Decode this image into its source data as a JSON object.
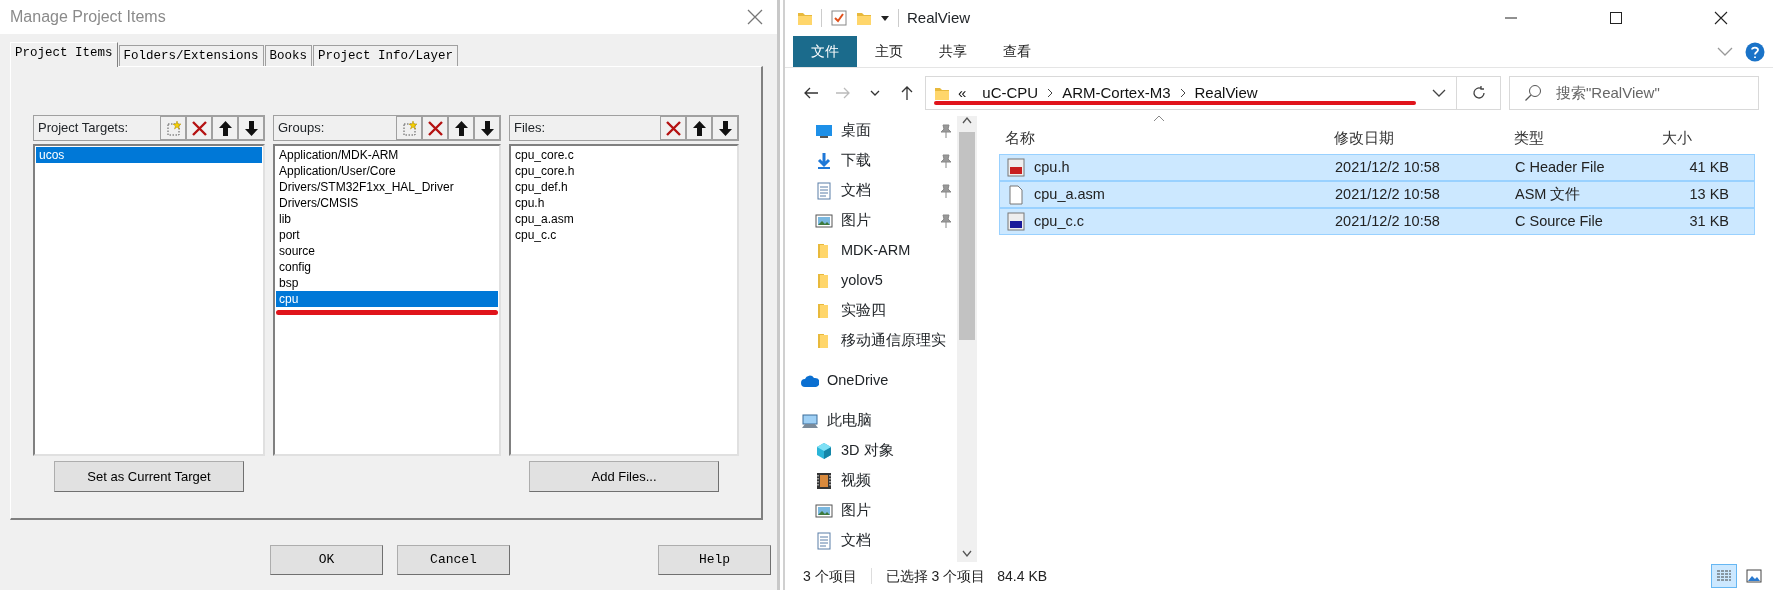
{
  "dialog": {
    "title": "Manage Project Items",
    "tabs": [
      {
        "label": "Project Items",
        "selected": true
      },
      {
        "label": "Folders/Extensions",
        "selected": false
      },
      {
        "label": "Books",
        "selected": false
      },
      {
        "label": "Project Info/Layer",
        "selected": false
      }
    ],
    "panels": [
      {
        "label": "Project Targets:",
        "tools": [
          {
            "kind": "new"
          },
          {
            "kind": "delete"
          },
          {
            "kind": "up"
          },
          {
            "kind": "down"
          }
        ],
        "items": [
          {
            "label": "ucos",
            "selected": true,
            "underlined": false
          }
        ],
        "button": "Set as Current Target"
      },
      {
        "label": "Groups:",
        "tools": [
          {
            "kind": "new"
          },
          {
            "kind": "delete"
          },
          {
            "kind": "up"
          },
          {
            "kind": "down"
          }
        ],
        "items": [
          {
            "label": "Application/MDK-ARM",
            "selected": false,
            "underlined": false
          },
          {
            "label": "Application/User/Core",
            "selected": false,
            "underlined": false
          },
          {
            "label": "Drivers/STM32F1xx_HAL_Driver",
            "selected": false,
            "underlined": false
          },
          {
            "label": "Drivers/CMSIS",
            "selected": false,
            "underlined": false
          },
          {
            "label": "lib",
            "selected": false,
            "underlined": false
          },
          {
            "label": "port",
            "selected": false,
            "underlined": false
          },
          {
            "label": "source",
            "selected": false,
            "underlined": false
          },
          {
            "label": "config",
            "selected": false,
            "underlined": false
          },
          {
            "label": "bsp",
            "selected": false,
            "underlined": false
          },
          {
            "label": "cpu",
            "selected": true,
            "underlined": true
          }
        ]
      },
      {
        "label": "Files:",
        "tools": [
          {
            "kind": "delete"
          },
          {
            "kind": "up"
          },
          {
            "kind": "down"
          }
        ],
        "items": [
          {
            "label": "cpu_core.c",
            "selected": false,
            "underlined": false
          },
          {
            "label": "cpu_core.h",
            "selected": false,
            "underlined": false
          },
          {
            "label": "cpu_def.h",
            "selected": false,
            "underlined": false
          },
          {
            "label": "cpu.h",
            "selected": false,
            "underlined": false
          },
          {
            "label": "cpu_a.asm",
            "selected": false,
            "underlined": false
          },
          {
            "label": "cpu_c.c",
            "selected": false,
            "underlined": false
          }
        ],
        "button": "Add Files..."
      }
    ],
    "buttons": [
      "OK",
      "Cancel",
      "Help"
    ]
  },
  "explorer": {
    "title": "RealView",
    "ribbon_tabs": [
      {
        "label": "文件",
        "selected": true
      },
      {
        "label": "主页",
        "selected": false
      },
      {
        "label": "共享",
        "selected": false
      },
      {
        "label": "查看",
        "selected": false
      }
    ],
    "address": {
      "overflow": "«",
      "crumbs": [
        "uC-CPU",
        "ARM-Cortex-M3",
        "RealView"
      ],
      "underlined": true
    },
    "search": {
      "placeholder": "搜索\"RealView\""
    },
    "quick_access": [
      {
        "label": "桌面",
        "kind": "desktop",
        "pinned": true
      },
      {
        "label": "下载",
        "kind": "download",
        "pinned": true
      },
      {
        "label": "文档",
        "kind": "document",
        "pinned": true
      },
      {
        "label": "图片",
        "kind": "pictures",
        "pinned": true
      },
      {
        "label": "MDK-ARM",
        "kind": "folder",
        "pinned": false
      },
      {
        "label": "yolov5",
        "kind": "folder",
        "pinned": false
      },
      {
        "label": "实验四",
        "kind": "folder",
        "pinned": false
      },
      {
        "label": "移动通信原理实",
        "kind": "folder",
        "pinned": false
      }
    ],
    "locations": [
      {
        "label": "OneDrive",
        "kind": "cloud"
      },
      {
        "label": "此电脑",
        "kind": "computer",
        "children": [
          {
            "label": "3D 对象",
            "kind": "cube"
          },
          {
            "label": "视频",
            "kind": "video"
          },
          {
            "label": "图片",
            "kind": "pictures"
          },
          {
            "label": "文档",
            "kind": "document"
          }
        ]
      }
    ],
    "columns": [
      "名称",
      "修改日期",
      "类型",
      "大小"
    ],
    "files": [
      {
        "name": "cpu.h",
        "modified": "2021/12/2 10:58",
        "type": "C Header File",
        "size": "41 KB",
        "kind": "header",
        "selected": true
      },
      {
        "name": "cpu_a.asm",
        "modified": "2021/12/2 10:58",
        "type": "ASM 文件",
        "size": "13 KB",
        "kind": "plain",
        "selected": true
      },
      {
        "name": "cpu_c.c",
        "modified": "2021/12/2 10:58",
        "type": "C Source File",
        "size": "31 KB",
        "kind": "csource",
        "selected": true
      }
    ],
    "status": {
      "count": "3 个项目",
      "selection": "已选择 3 个项目",
      "size": "84.4 KB"
    }
  }
}
